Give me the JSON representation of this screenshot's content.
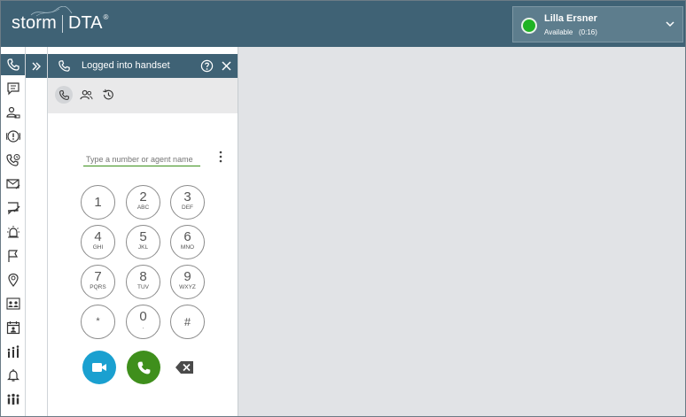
{
  "header": {
    "logo_storm": "storm",
    "logo_dta": "DTA",
    "logo_reg": "®",
    "user": {
      "name": "Lilla Ersner",
      "status": "Available",
      "timer": "(0:16)",
      "status_color": "#1fb324"
    }
  },
  "panel": {
    "title": "Logged into handset",
    "search_placeholder": "Type a number or agent name",
    "keys": [
      {
        "num": "1",
        "letters": ""
      },
      {
        "num": "2",
        "letters": "ABC"
      },
      {
        "num": "3",
        "letters": "DEF"
      },
      {
        "num": "4",
        "letters": "GHI"
      },
      {
        "num": "5",
        "letters": "JKL"
      },
      {
        "num": "6",
        "letters": "MNO"
      },
      {
        "num": "7",
        "letters": "PQRS"
      },
      {
        "num": "8",
        "letters": "TUV"
      },
      {
        "num": "9",
        "letters": "WXYZ"
      },
      {
        "num": "*",
        "letters": ""
      },
      {
        "num": "0",
        "letters": "."
      },
      {
        "num": "#",
        "letters": ""
      }
    ]
  },
  "colors": {
    "brand": "#3f6275",
    "video": "#1aa0d0",
    "call": "#3f8f1c"
  }
}
